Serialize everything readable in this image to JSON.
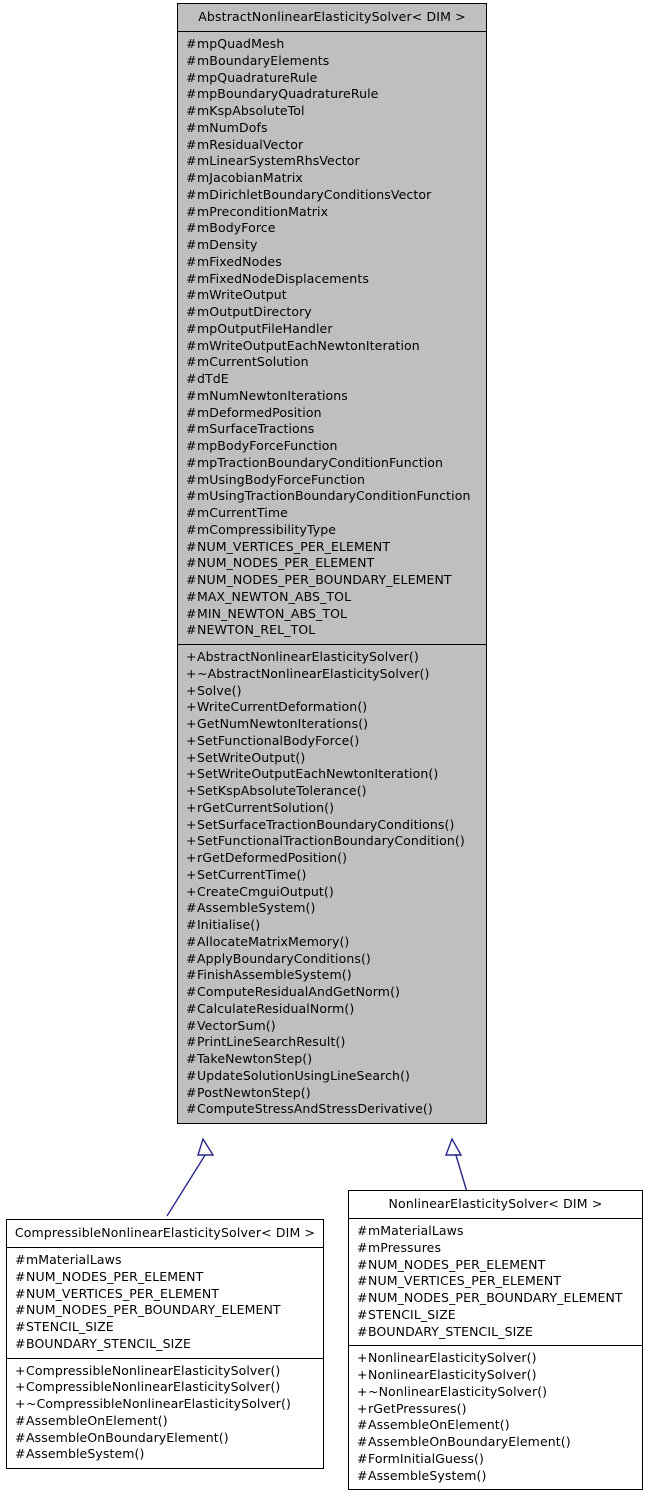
{
  "diagram": {
    "type": "uml-class-inheritance",
    "notation": {
      "public_symbol": "+",
      "protected_symbol": "#",
      "arrow_color": "#26268c",
      "base_class_fill": "#bfbfbf",
      "subclass_fill": "#ffffff",
      "border_color": "#000000"
    }
  },
  "base_class": {
    "name": "AbstractNonlinearElasticitySolver< DIM >",
    "attributes": [
      {
        "vis": "#",
        "label": "mpQuadMesh"
      },
      {
        "vis": "#",
        "label": "mBoundaryElements"
      },
      {
        "vis": "#",
        "label": "mpQuadratureRule"
      },
      {
        "vis": "#",
        "label": "mpBoundaryQuadratureRule"
      },
      {
        "vis": "#",
        "label": "mKspAbsoluteTol"
      },
      {
        "vis": "#",
        "label": "mNumDofs"
      },
      {
        "vis": "#",
        "label": "mResidualVector"
      },
      {
        "vis": "#",
        "label": "mLinearSystemRhsVector"
      },
      {
        "vis": "#",
        "label": "mJacobianMatrix"
      },
      {
        "vis": "#",
        "label": "mDirichletBoundaryConditionsVector"
      },
      {
        "vis": "#",
        "label": "mPreconditionMatrix"
      },
      {
        "vis": "#",
        "label": "mBodyForce"
      },
      {
        "vis": "#",
        "label": "mDensity"
      },
      {
        "vis": "#",
        "label": "mFixedNodes"
      },
      {
        "vis": "#",
        "label": "mFixedNodeDisplacements"
      },
      {
        "vis": "#",
        "label": "mWriteOutput"
      },
      {
        "vis": "#",
        "label": "mOutputDirectory"
      },
      {
        "vis": "#",
        "label": "mpOutputFileHandler"
      },
      {
        "vis": "#",
        "label": "mWriteOutputEachNewtonIteration"
      },
      {
        "vis": "#",
        "label": "mCurrentSolution"
      },
      {
        "vis": "#",
        "label": "dTdE"
      },
      {
        "vis": "#",
        "label": "mNumNewtonIterations"
      },
      {
        "vis": "#",
        "label": "mDeformedPosition"
      },
      {
        "vis": "#",
        "label": "mSurfaceTractions"
      },
      {
        "vis": "#",
        "label": "mpBodyForceFunction"
      },
      {
        "vis": "#",
        "label": "mpTractionBoundaryConditionFunction"
      },
      {
        "vis": "#",
        "label": "mUsingBodyForceFunction"
      },
      {
        "vis": "#",
        "label": "mUsingTractionBoundaryConditionFunction"
      },
      {
        "vis": "#",
        "label": "mCurrentTime"
      },
      {
        "vis": "#",
        "label": "mCompressibilityType"
      },
      {
        "vis": "#",
        "label": "NUM_VERTICES_PER_ELEMENT"
      },
      {
        "vis": "#",
        "label": "NUM_NODES_PER_ELEMENT"
      },
      {
        "vis": "#",
        "label": "NUM_NODES_PER_BOUNDARY_ELEMENT"
      },
      {
        "vis": "#",
        "label": "MAX_NEWTON_ABS_TOL"
      },
      {
        "vis": "#",
        "label": "MIN_NEWTON_ABS_TOL"
      },
      {
        "vis": "#",
        "label": "NEWTON_REL_TOL"
      }
    ],
    "methods": [
      {
        "vis": "+",
        "label": "AbstractNonlinearElasticitySolver()"
      },
      {
        "vis": "+",
        "label": "~AbstractNonlinearElasticitySolver()"
      },
      {
        "vis": "+",
        "label": "Solve()"
      },
      {
        "vis": "+",
        "label": "WriteCurrentDeformation()"
      },
      {
        "vis": "+",
        "label": "GetNumNewtonIterations()"
      },
      {
        "vis": "+",
        "label": "SetFunctionalBodyForce()"
      },
      {
        "vis": "+",
        "label": "SetWriteOutput()"
      },
      {
        "vis": "+",
        "label": "SetWriteOutputEachNewtonIteration()"
      },
      {
        "vis": "+",
        "label": "SetKspAbsoluteTolerance()"
      },
      {
        "vis": "+",
        "label": "rGetCurrentSolution()"
      },
      {
        "vis": "+",
        "label": "SetSurfaceTractionBoundaryConditions()"
      },
      {
        "vis": "+",
        "label": "SetFunctionalTractionBoundaryCondition()"
      },
      {
        "vis": "+",
        "label": "rGetDeformedPosition()"
      },
      {
        "vis": "+",
        "label": "SetCurrentTime()"
      },
      {
        "vis": "+",
        "label": "CreateCmguiOutput()"
      },
      {
        "vis": "#",
        "label": "AssembleSystem()"
      },
      {
        "vis": "#",
        "label": "Initialise()"
      },
      {
        "vis": "#",
        "label": "AllocateMatrixMemory()"
      },
      {
        "vis": "#",
        "label": "ApplyBoundaryConditions()"
      },
      {
        "vis": "#",
        "label": "FinishAssembleSystem()"
      },
      {
        "vis": "#",
        "label": "ComputeResidualAndGetNorm()"
      },
      {
        "vis": "#",
        "label": "CalculateResidualNorm()"
      },
      {
        "vis": "#",
        "label": "VectorSum()"
      },
      {
        "vis": "#",
        "label": "PrintLineSearchResult()"
      },
      {
        "vis": "#",
        "label": "TakeNewtonStep()"
      },
      {
        "vis": "#",
        "label": "UpdateSolutionUsingLineSearch()"
      },
      {
        "vis": "#",
        "label": "PostNewtonStep()"
      },
      {
        "vis": "#",
        "label": "ComputeStressAndStressDerivative()"
      }
    ]
  },
  "subclass_left": {
    "name": "CompressibleNonlinearElasticitySolver< DIM >",
    "attributes": [
      {
        "vis": "#",
        "label": "mMaterialLaws"
      },
      {
        "vis": "#",
        "label": "NUM_NODES_PER_ELEMENT"
      },
      {
        "vis": "#",
        "label": "NUM_VERTICES_PER_ELEMENT"
      },
      {
        "vis": "#",
        "label": "NUM_NODES_PER_BOUNDARY_ELEMENT"
      },
      {
        "vis": "#",
        "label": "STENCIL_SIZE"
      },
      {
        "vis": "#",
        "label": "BOUNDARY_STENCIL_SIZE"
      }
    ],
    "methods": [
      {
        "vis": "+",
        "label": "CompressibleNonlinearElasticitySolver()"
      },
      {
        "vis": "+",
        "label": "CompressibleNonlinearElasticitySolver()"
      },
      {
        "vis": "+",
        "label": "~CompressibleNonlinearElasticitySolver()"
      },
      {
        "vis": "#",
        "label": "AssembleOnElement()"
      },
      {
        "vis": "#",
        "label": "AssembleOnBoundaryElement()"
      },
      {
        "vis": "#",
        "label": "AssembleSystem()"
      }
    ]
  },
  "subclass_right": {
    "name": "NonlinearElasticitySolver< DIM >",
    "attributes": [
      {
        "vis": "#",
        "label": "mMaterialLaws"
      },
      {
        "vis": "#",
        "label": "mPressures"
      },
      {
        "vis": "#",
        "label": "NUM_NODES_PER_ELEMENT"
      },
      {
        "vis": "#",
        "label": "NUM_VERTICES_PER_ELEMENT"
      },
      {
        "vis": "#",
        "label": "NUM_NODES_PER_BOUNDARY_ELEMENT"
      },
      {
        "vis": "#",
        "label": "STENCIL_SIZE"
      },
      {
        "vis": "#",
        "label": "BOUNDARY_STENCIL_SIZE"
      }
    ],
    "methods": [
      {
        "vis": "+",
        "label": "NonlinearElasticitySolver()"
      },
      {
        "vis": "+",
        "label": "NonlinearElasticitySolver()"
      },
      {
        "vis": "+",
        "label": "~NonlinearElasticitySolver()"
      },
      {
        "vis": "+",
        "label": "rGetPressures()"
      },
      {
        "vis": "#",
        "label": "AssembleOnElement()"
      },
      {
        "vis": "#",
        "label": "AssembleOnBoundaryElement()"
      },
      {
        "vis": "#",
        "label": "FormInitialGuess()"
      },
      {
        "vis": "#",
        "label": "AssembleSystem()"
      }
    ]
  }
}
